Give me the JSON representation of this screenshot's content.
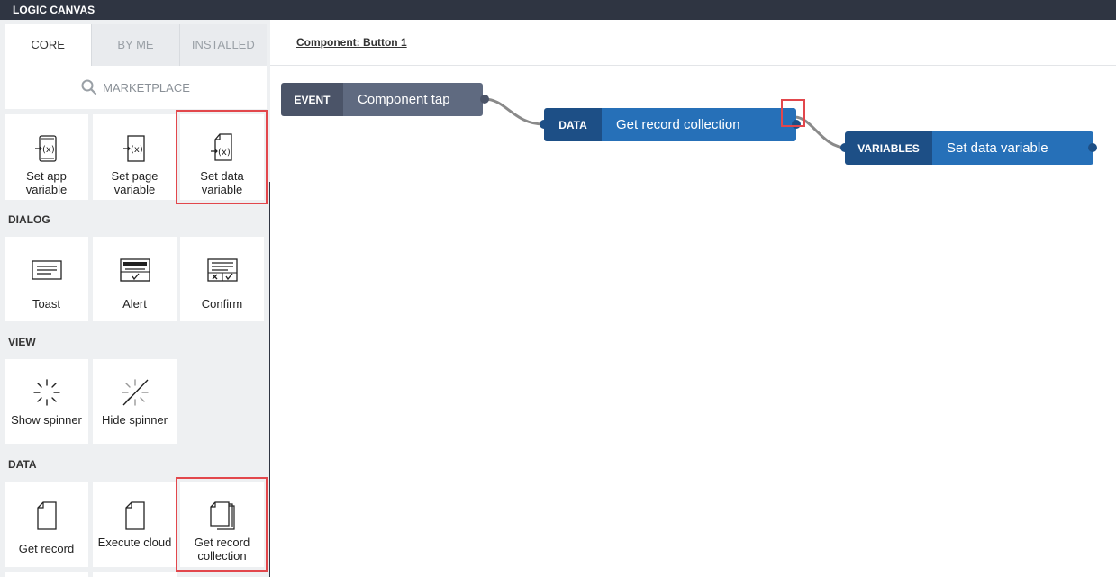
{
  "app": {
    "title": "LOGIC CANVAS"
  },
  "sidebar": {
    "tabs": [
      {
        "label": "CORE",
        "active": true
      },
      {
        "label": "BY ME",
        "active": false
      },
      {
        "label": "INSTALLED",
        "active": false
      }
    ],
    "marketplace_label": "MARKETPLACE",
    "variables_tiles": [
      {
        "label": "Set app variable",
        "icon": "set-app-variable-icon"
      },
      {
        "label": "Set page variable",
        "icon": "set-page-variable-icon"
      },
      {
        "label": "Set data variable",
        "icon": "set-data-variable-icon",
        "highlighted": true
      }
    ],
    "dialog_section": "DIALOG",
    "dialog_tiles": [
      {
        "label": "Toast",
        "icon": "toast-icon"
      },
      {
        "label": "Alert",
        "icon": "alert-icon"
      },
      {
        "label": "Confirm",
        "icon": "confirm-icon"
      }
    ],
    "view_section": "VIEW",
    "view_tiles": [
      {
        "label": "Show spinner",
        "icon": "show-spinner-icon"
      },
      {
        "label": "Hide spinner",
        "icon": "hide-spinner-icon"
      }
    ],
    "data_section": "DATA",
    "data_tiles": [
      {
        "label": "Get record",
        "icon": "get-record-icon"
      },
      {
        "label": "Execute cloud",
        "icon": "execute-cloud-icon"
      },
      {
        "label": "Get record collection",
        "icon": "get-record-collection-icon",
        "highlighted": true
      }
    ]
  },
  "canvas": {
    "breadcrumb": "Component: Button 1",
    "nodes": [
      {
        "kind": "EVENT",
        "name": "Component tap"
      },
      {
        "kind": "DATA",
        "name": "Get record collection"
      },
      {
        "kind": "VARIABLES",
        "name": "Set data variable"
      }
    ]
  },
  "colors": {
    "titlebar": "#2f3542",
    "event_kind": "#4b5468",
    "event_name": "#5f6a80",
    "data_kind": "#1d4f86",
    "data_name": "#2670b8",
    "highlight": "#e2474c"
  }
}
